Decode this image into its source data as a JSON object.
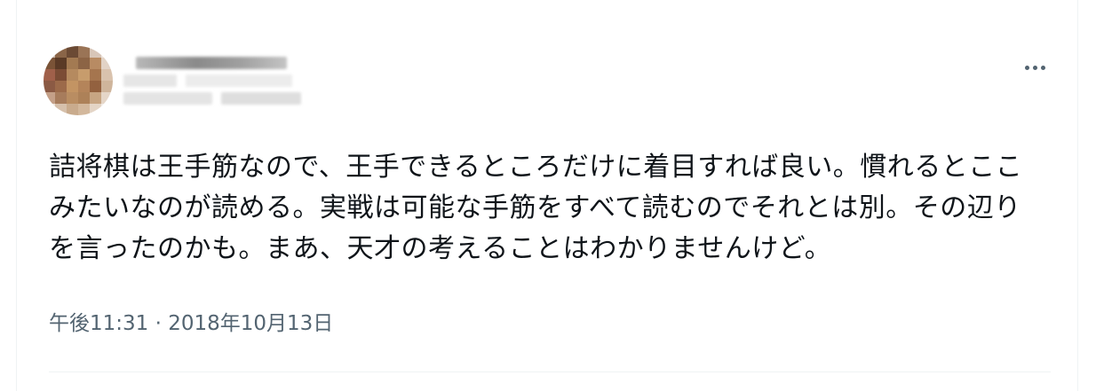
{
  "tweet": {
    "author": {
      "avatar_label": "avatar (pixelated)",
      "name_obscured": true
    },
    "more_icon": "more-horizontal-icon",
    "text_lines": [
      "詰将棋は王手筋なので、王手できるところだけに着目すれば良い。慣れるとここ",
      "みたいなのが読める。実戦は可能な手筋をすべて読むのでそれとは別。その辺り",
      "を言ったのかも。まあ、天才の考えることはわかりませんけど。"
    ],
    "time": "午後11:31",
    "separator": "·",
    "date": "2018年10月13日"
  },
  "colors": {
    "text": "#0f1419",
    "secondary": "#536471",
    "border": "#eff3f4"
  }
}
